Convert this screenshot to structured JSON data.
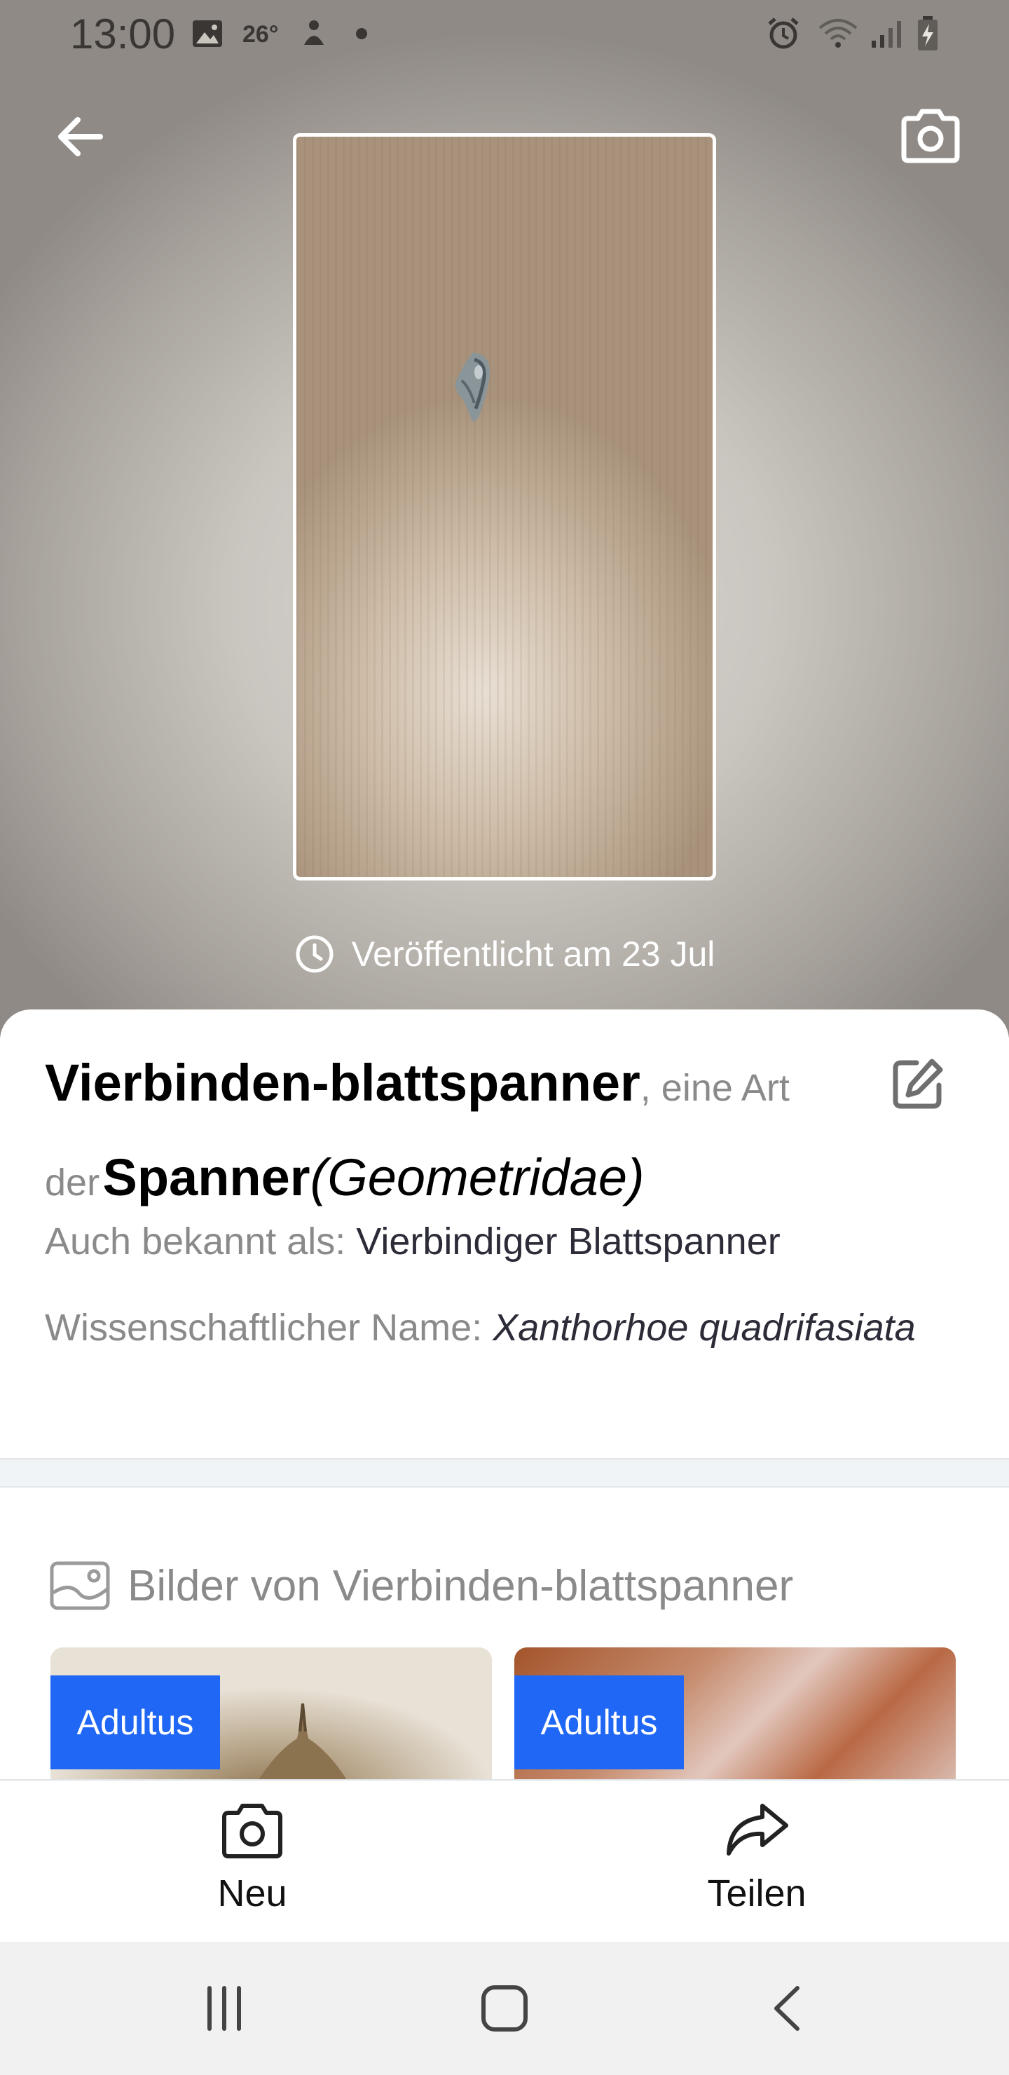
{
  "status_bar": {
    "time": "13:00",
    "temperature": "26°",
    "icons": [
      "image-icon",
      "temperature-icon",
      "notification-icon",
      "dot-icon",
      "alarm-icon",
      "wifi-icon",
      "signal-icon",
      "battery-icon"
    ]
  },
  "header": {
    "back_icon": "arrow-left-icon",
    "camera_icon": "camera-icon",
    "published_label": "Veröffentlicht am 23 Jul"
  },
  "species": {
    "common_name": "Vierbinden-blattspanner",
    "kind_text_1": ", eine Art",
    "kind_text_2": "der",
    "group_name": "Spanner",
    "group_latin": "(Geometridae)",
    "aka_label": "Auch bekannt als:",
    "aka_value": "Vierbindiger Blattspanner",
    "sci_label": "Wissenschaftlicher Name:",
    "sci_value": "Xanthorhoe quadrifasiata"
  },
  "gallery": {
    "title": "Bilder von Vierbinden-blattspanner",
    "items": [
      {
        "badge": "Adultus"
      },
      {
        "badge": "Adultus"
      }
    ]
  },
  "actions": {
    "new_label": "Neu",
    "share_label": "Teilen"
  },
  "colors": {
    "accent": "#1f67f4",
    "muted_text": "#8a8a8a",
    "nav_bg": "#f1f1f1"
  }
}
